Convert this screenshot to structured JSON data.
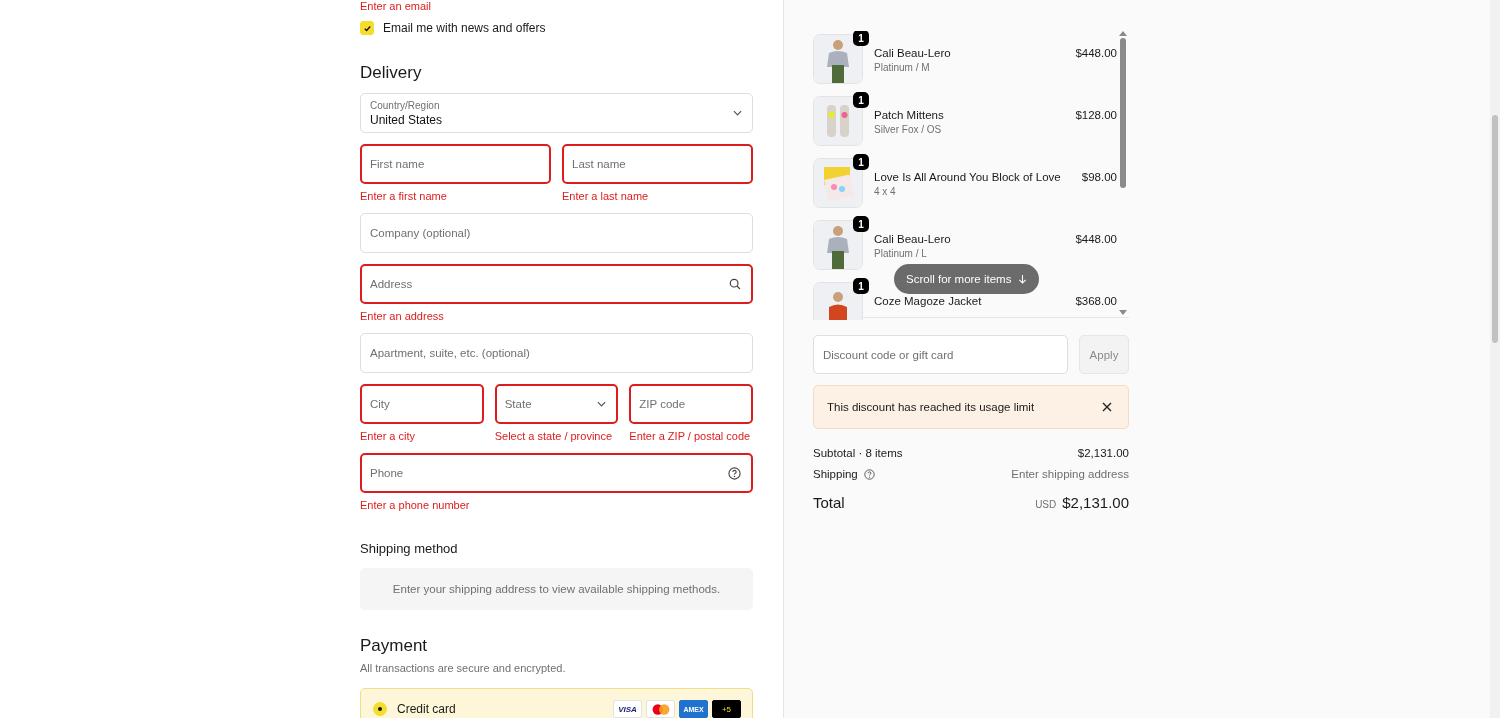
{
  "contact": {
    "error": "Enter an email",
    "newsletter": {
      "label": "Email me with news and offers",
      "checked": true
    }
  },
  "delivery": {
    "title": "Delivery",
    "rows": [
      [
        {
          "kind": "select",
          "label": "Country/Region",
          "value": "United States",
          "invalid": false
        }
      ],
      [
        {
          "kind": "text",
          "placeholder": "First name",
          "invalid": true,
          "error": "Enter a first name"
        },
        {
          "kind": "text",
          "placeholder": "Last name",
          "invalid": true,
          "error": "Enter a last name"
        }
      ],
      [
        {
          "kind": "text",
          "placeholder": "Company (optional)",
          "invalid": false
        }
      ],
      [
        {
          "kind": "search",
          "placeholder": "Address",
          "invalid": true,
          "error": "Enter an address"
        }
      ],
      [
        {
          "kind": "text",
          "placeholder": "Apartment, suite, etc. (optional)",
          "invalid": false
        }
      ],
      [
        {
          "kind": "text",
          "placeholder": "City",
          "invalid": true,
          "error": "Enter a city"
        },
        {
          "kind": "select",
          "placeholder": "State",
          "invalid": true,
          "error": "Select a state / province"
        },
        {
          "kind": "text",
          "placeholder": "ZIP code",
          "invalid": true,
          "error": "Enter a ZIP / postal code"
        }
      ],
      [
        {
          "kind": "help",
          "placeholder": "Phone",
          "invalid": true,
          "error": "Enter a phone number"
        }
      ]
    ]
  },
  "shipping": {
    "title": "Shipping method",
    "message": "Enter your shipping address to view available shipping methods."
  },
  "payment": {
    "title": "Payment",
    "subtitle": "All transactions are secure and encrypted.",
    "methods": [
      {
        "label": "Credit card",
        "selected": true,
        "cards": [
          {
            "kind": "visa",
            "text": "VISA"
          },
          {
            "kind": "mastercard"
          },
          {
            "kind": "amex",
            "text": "AMEX"
          },
          {
            "kind": "more",
            "text": "+5"
          }
        ]
      }
    ]
  },
  "summary": {
    "items": [
      {
        "quantity": "1",
        "name": "Cali Beau-Lero",
        "variant": "Platinum / M",
        "price": "$448.00"
      },
      {
        "quantity": "1",
        "name": "Patch Mittens",
        "variant": "Silver Fox / OS",
        "price": "$128.00"
      },
      {
        "quantity": "1",
        "name": "Love Is All Around You Block of Love",
        "variant": "4 x 4",
        "price": "$98.00"
      },
      {
        "quantity": "1",
        "name": "Cali Beau-Lero",
        "variant": "Platinum / L",
        "price": "$448.00"
      },
      {
        "quantity": "1",
        "name": "Coze Magoze Jacket",
        "price": "$368.00"
      }
    ],
    "scroll_hint": "Scroll for more items",
    "discount": {
      "placeholder": "Discount code or gift card",
      "button": "Apply",
      "button_disabled": true
    },
    "notice": "This discount has reached its usage limit",
    "subtotal": {
      "label": "Subtotal · 8 items",
      "value": "$2,131.00"
    },
    "shipping": {
      "label": "Shipping",
      "value": "Enter shipping address"
    },
    "total": {
      "label": "Total",
      "currency": "USD",
      "value": "$2,131.00"
    }
  }
}
